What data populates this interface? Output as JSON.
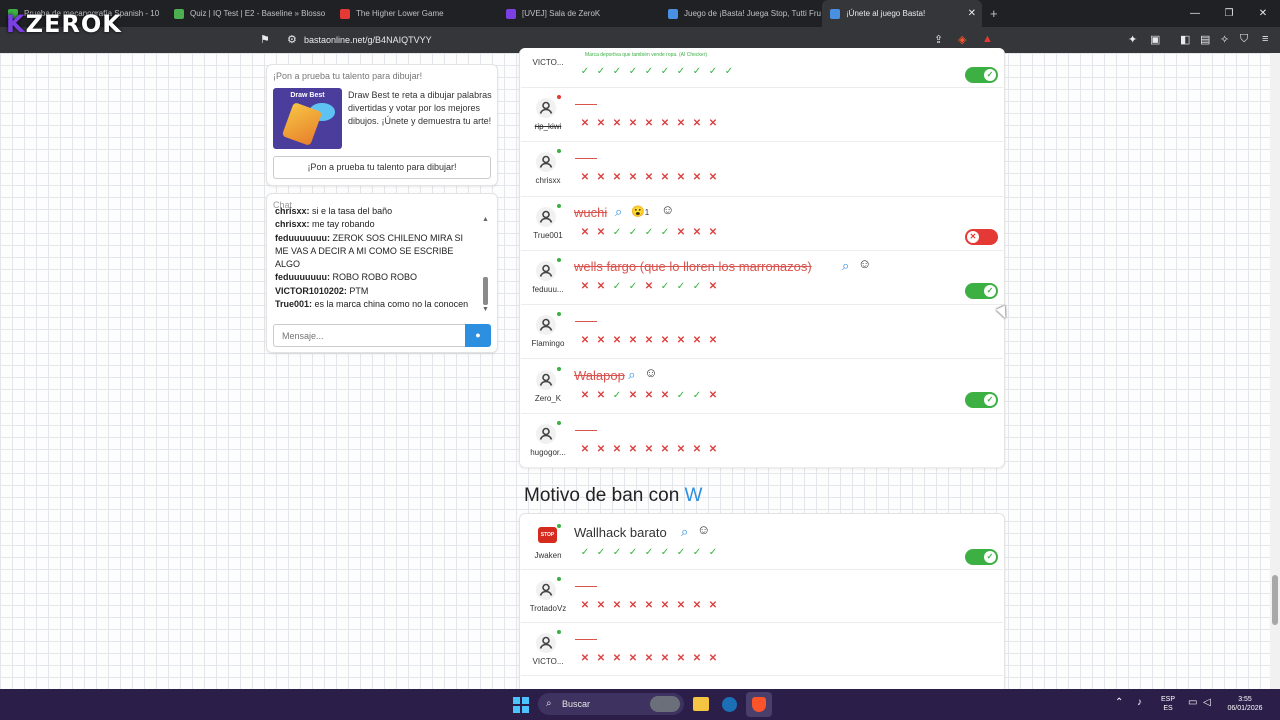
{
  "logo": {
    "k": "K",
    "rest": "ZEROK"
  },
  "tabs": [
    {
      "label": "Prueba de mecanografía Spanish - 10",
      "color": "#3cb043"
    },
    {
      "label": "Quiz | IQ Test | E2 - Baseline » Blosso",
      "color": "#4caf50"
    },
    {
      "label": "The Higher Lower Game",
      "color": "#e53935"
    },
    {
      "label": "[UVEJ] Sala de ZeroK",
      "color": "#7b3fe4"
    },
    {
      "label": "Juego de ¡Basta! Juega Stop, Tutti Fru",
      "color": "#4a90e2"
    },
    {
      "label": "¡Únete al juego Basta!",
      "color": "#4a90e2"
    }
  ],
  "address": {
    "url": "bastaonline.net/g/B4NAIQTVYY"
  },
  "sidebar": {
    "promo_title": "¡Pon a prueba tu talento para dibujar!",
    "promo_img_title": "Draw Best",
    "promo_text": "Draw Best te reta a dibujar palabras divertidas y votar por los mejores dibujos. ¡Únete y demuestra tu arte!",
    "promo_button": "¡Pon a prueba tu talento para dibujar!",
    "chat_title": "Chat",
    "chat_messages": [
      {
        "user": "chrisxx:",
        "text": " si e la tasa del baño"
      },
      {
        "user": "chrisxx:",
        "text": " me tay robando"
      },
      {
        "user": "feduuuuuuu:",
        "text": " ZEROK SOS CHILENO MIRA SI ME VAS A DECIR A MI COMO SE ESCRIBE ALGO"
      },
      {
        "user": "feduuuuuuu:",
        "text": " ROBO ROBO ROBO"
      },
      {
        "user": "VICTOR1010202:",
        "text": " PTM"
      },
      {
        "user": "True001:",
        "text": " es la marca china como no la conocen"
      }
    ],
    "chat_placeholder": "Mensaje..."
  },
  "top_row": {
    "user": "VICTO...",
    "note": "Marca deportiva que también vende ropa. (AI Checker)"
  },
  "answers1": [
    {
      "user": "rip_kiwi",
      "answer": "",
      "marks": "xxxxxxxxx",
      "dot": "#e53935"
    },
    {
      "user": "chrisxx",
      "answer": "",
      "marks": "xxxxxxxxx",
      "dot": "#3cb043"
    },
    {
      "user": "True001",
      "answer": "wuchi",
      "marks": "xxvvvvxxx",
      "dot": "#3cb043",
      "reaction": "😮",
      "reaction_count": "1",
      "toggle": "off"
    },
    {
      "user": "feduuu...",
      "answer": "wells fargo (que lo lloren los marronazos)",
      "marks": "xxvvxvvvx",
      "dot": "#3cb043",
      "toggle": "on"
    },
    {
      "user": "Flamingo",
      "answer": "",
      "marks": "xxxxxxxxx",
      "dot": "#3cb043"
    },
    {
      "user": "Zero_K",
      "answer": "Walapop",
      "marks": "xxvxxxvvx",
      "dot": "#3cb043",
      "toggle": "on"
    },
    {
      "user": "hugogor...",
      "answer": "",
      "marks": "xxxxxxxxx",
      "dot": "#3cb043"
    }
  ],
  "section": {
    "title": "Motivo de ban con ",
    "letter": "W"
  },
  "answers2": [
    {
      "user": "Jwaken",
      "answer": "Wallhack barato",
      "marks": "vvvvvvvvv",
      "dot": "#3cb043",
      "toggle": "on"
    },
    {
      "user": "TrotadoVz",
      "answer": "",
      "marks": "xxxxxxxxx",
      "dot": "#3cb043"
    },
    {
      "user": "VICTO...",
      "answer": "",
      "marks": "xxxxxxxxx",
      "dot": "#3cb043"
    }
  ],
  "taskbar": {
    "search": "Buscar",
    "lang1": "ESP",
    "lang2": "ES",
    "time": "3:55",
    "date": "06/01/2026"
  },
  "colors": {
    "ok": "#3cb043",
    "bad": "#d9534f",
    "accent": "#2d8fe0"
  }
}
